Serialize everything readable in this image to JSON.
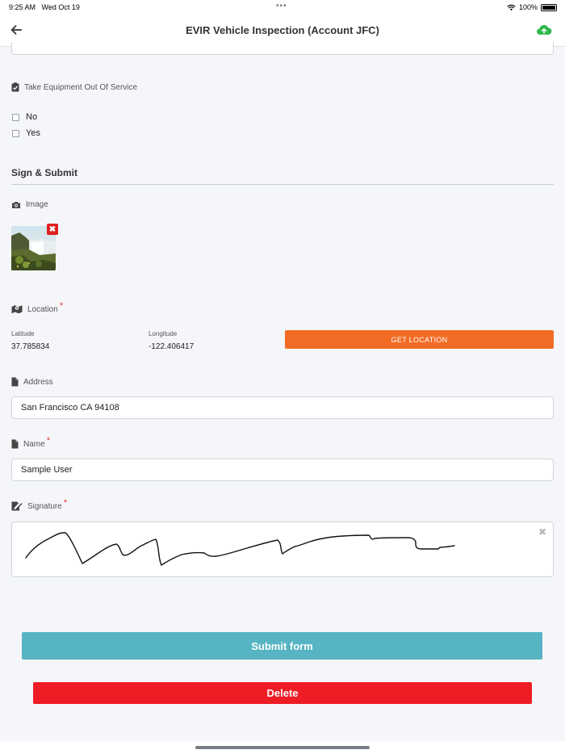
{
  "status_bar": {
    "time": "9:25 AM",
    "date": "Wed Oct 19",
    "battery": "100%"
  },
  "nav": {
    "title": "EVIR Vehicle Inspection (Account JFC)"
  },
  "equipment": {
    "label": "Take Equipment Out Of Service",
    "options": [
      "No",
      "Yes"
    ]
  },
  "section": {
    "title": "Sign & Submit"
  },
  "image": {
    "label": "Image",
    "remove_icon": "✖"
  },
  "location": {
    "label": "Location",
    "required_mark": "*",
    "latitude_label": "Latitude",
    "latitude": "37.785834",
    "longitude_label": "Longitude",
    "longitude": "-122.406417",
    "button": "GET LOCATION"
  },
  "address": {
    "label": "Address",
    "value": "San Francisco CA 94108"
  },
  "name": {
    "label": "Name",
    "required_mark": "*",
    "value": "Sample User"
  },
  "signature": {
    "label": "Signature",
    "required_mark": "*",
    "clear_icon": "✖"
  },
  "actions": {
    "submit": "Submit form",
    "delete": "Delete"
  },
  "colors": {
    "accent_orange": "#f26b25",
    "submit_teal": "#56b4c3",
    "delete_red": "#ee1c25",
    "upload_green": "#2db84b"
  },
  "icons": {
    "back": "arrow-left-icon",
    "upload": "cloud-upload-icon",
    "equipment": "clipboard-check-icon",
    "image": "camera-icon",
    "location": "map-icon",
    "address": "file-icon",
    "name": "file-icon",
    "signature": "signature-icon"
  }
}
